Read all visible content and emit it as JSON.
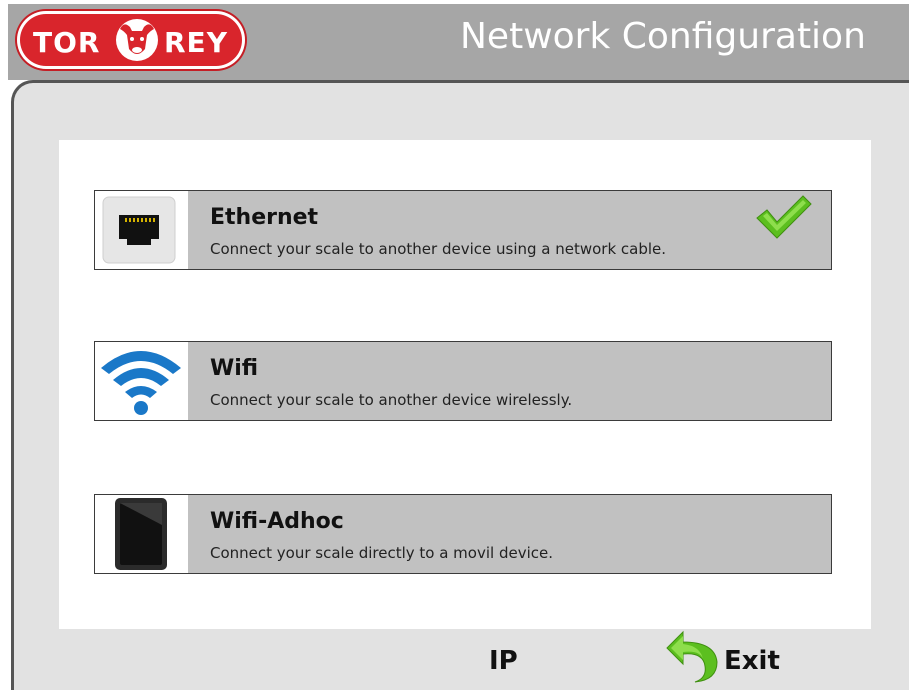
{
  "header": {
    "logo_left": "TOR",
    "logo_right": "REY",
    "title": "Network Configuration"
  },
  "options": [
    {
      "title": "Ethernet",
      "description": "Connect your scale to another device using a network cable.",
      "icon": "ethernet-port-icon",
      "selected": true
    },
    {
      "title": "Wifi",
      "description": "Connect your scale to another device wirelessly.",
      "icon": "wifi-icon",
      "selected": false
    },
    {
      "title": "Wifi-Adhoc",
      "description": "Connect your scale directly to a movil device.",
      "icon": "tablet-icon",
      "selected": false
    }
  ],
  "footer": {
    "ip_label": "IP",
    "exit_label": "Exit"
  },
  "colors": {
    "header_bg": "#a6a6a6",
    "logo_red": "#d9252c",
    "check_green": "#5cbf1f",
    "wifi_blue": "#1a78c8",
    "option_bg": "#c1c1c1"
  }
}
